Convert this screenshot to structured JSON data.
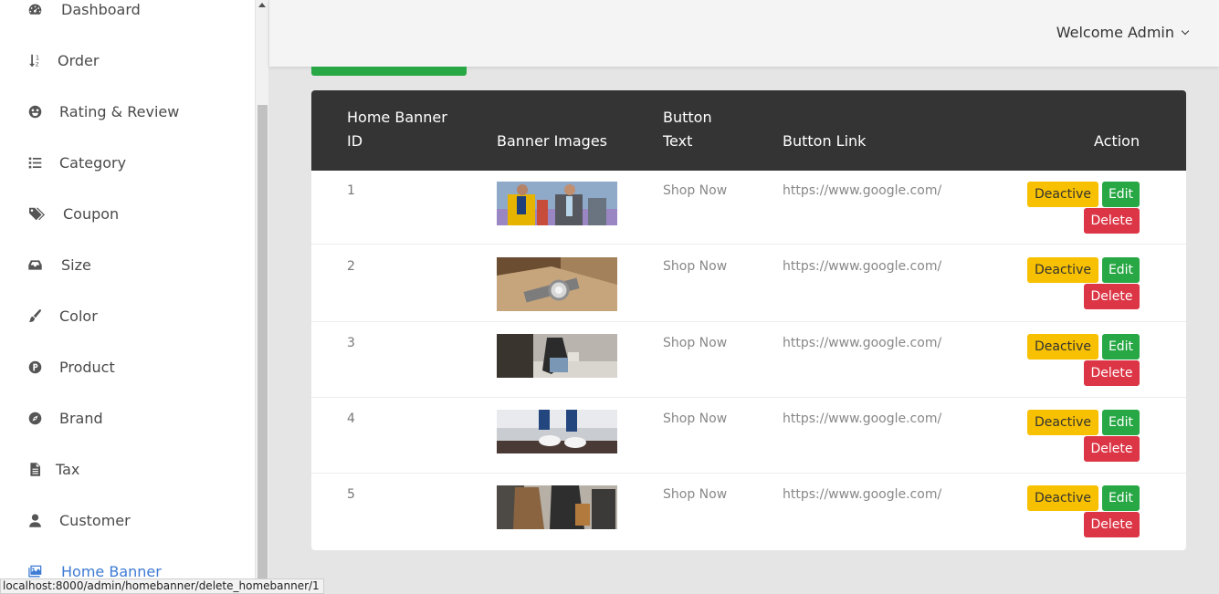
{
  "sidebar": {
    "items": [
      {
        "label": "Dashboard",
        "icon": "dashboard-icon"
      },
      {
        "label": "Order",
        "icon": "sort-icon"
      },
      {
        "label": "Rating & Review",
        "icon": "smile-icon"
      },
      {
        "label": "Category",
        "icon": "list-icon"
      },
      {
        "label": "Coupon",
        "icon": "tags-icon"
      },
      {
        "label": "Size",
        "icon": "inbox-icon"
      },
      {
        "label": "Color",
        "icon": "brush-icon"
      },
      {
        "label": "Product",
        "icon": "product-icon"
      },
      {
        "label": "Brand",
        "icon": "compass-icon"
      },
      {
        "label": "Tax",
        "icon": "file-icon"
      },
      {
        "label": "Customer",
        "icon": "user-icon"
      },
      {
        "label": "Home Banner",
        "icon": "image-icon",
        "active": true
      }
    ]
  },
  "header": {
    "welcome": "Welcome Admin"
  },
  "table": {
    "headers": {
      "id_line1": "Home Banner",
      "id_line2": "ID",
      "images": "Banner Images",
      "text_line1": "Button",
      "text_line2": "Text",
      "link": "Button Link",
      "action": "Action"
    },
    "rows": [
      {
        "id": "1",
        "button_text": "Shop Now",
        "button_link": "https://www.google.com/",
        "deactive": "Deactive",
        "edit": "Edit",
        "delete": "Delete"
      },
      {
        "id": "2",
        "button_text": "Shop Now",
        "button_link": "https://www.google.com/",
        "deactive": "Deactive",
        "edit": "Edit",
        "delete": "Delete"
      },
      {
        "id": "3",
        "button_text": "Shop Now",
        "button_link": "https://www.google.com/",
        "deactive": "Deactive",
        "edit": "Edit",
        "delete": "Delete"
      },
      {
        "id": "4",
        "button_text": "Shop Now",
        "button_link": "https://www.google.com/",
        "deactive": "Deactive",
        "edit": "Edit",
        "delete": "Delete"
      },
      {
        "id": "5",
        "button_text": "Shop Now",
        "button_link": "https://www.google.com/",
        "deactive": "Deactive",
        "edit": "Edit",
        "delete": "Delete"
      }
    ]
  },
  "statusbar": {
    "url": "localhost:8000/admin/homebanner/delete_homebanner/1"
  },
  "colors": {
    "accent": "#3e7bd4",
    "header_bg": "#343434",
    "deactive": "#f7c000",
    "edit": "#28a745",
    "delete": "#dc3545"
  }
}
